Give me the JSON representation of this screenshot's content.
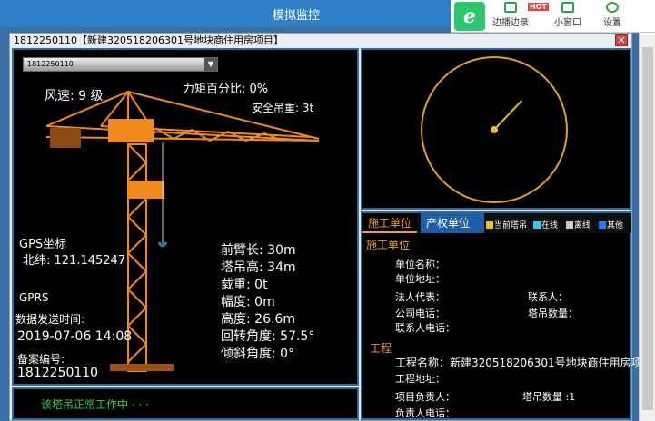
{
  "window": {
    "title": "模拟监控"
  },
  "toolbar": {
    "side_record": "边播边录",
    "hot": "HOT",
    "mini_window": "小窗口",
    "settings": "设置"
  },
  "panel": {
    "title": "1812250110【新建320518206301号地块商住用房项目】",
    "close": "✕"
  },
  "left": {
    "device_select": "1812250110",
    "wind": "风速: 9 级",
    "torque": "力矩百分比: 0%",
    "safe_load": "安全吊重: 3t",
    "gps_label": "GPS坐标",
    "latitude": "北纬: 121.145247",
    "gprs": "GPRS",
    "send_time_label": "数据发送时间:",
    "send_time": "2019-07-06 14:08",
    "record_label": "备案编号:",
    "record_no": "1812250110",
    "jib": "前臂长: 30m",
    "height_tower": "塔吊高: 34m",
    "load": "载重: 0t",
    "radius": "幅度: 0m",
    "height": "高度: 26.6m",
    "rotation": "回转角度: 57.5°",
    "tilt": "倾斜角度: 0°",
    "status": "该塔吊正常工作中 · · ·"
  },
  "dial": {
    "rotation_deg": 57.5
  },
  "right": {
    "tabs": [
      "施工单位",
      "产权单位"
    ],
    "legend": [
      {
        "label": "当前塔吊",
        "color": "#f0c020"
      },
      {
        "label": "在线",
        "color": "#20d0f0"
      },
      {
        "label": "离线",
        "color": "#c8c8c8"
      },
      {
        "label": "其他",
        "color": "#2080f0"
      }
    ],
    "construction_title": "施工单位",
    "unit_name": "单位名称：",
    "unit_addr": "单位地址：",
    "legal_rep": "法人代表：",
    "contact": "联系人：",
    "company_phone": "公司电话：",
    "crane_count": "塔吊数量：",
    "contact_phone": "联系人电话：",
    "project_title": "工程",
    "project_name": "工程名称：新建320518206301号地块商住用房项",
    "project_addr": "工程地址：",
    "project_leader": "项目负责人：",
    "crane_count2": "塔吊数量 :1",
    "leader_phone": "负责人电话："
  }
}
